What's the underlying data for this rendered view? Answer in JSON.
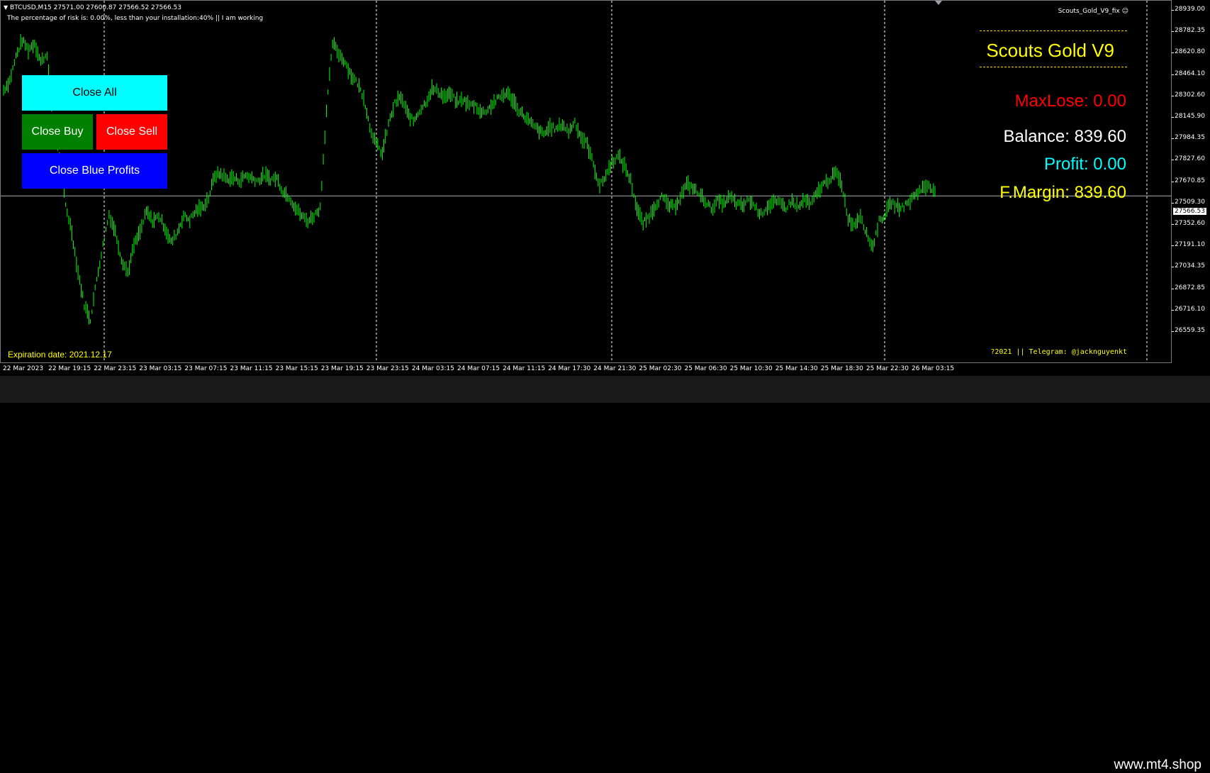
{
  "header": {
    "symbol_line": "BTCUSD,M15  27571.00 27600.87 27566.52 27566.53",
    "status_line": "The percentage of risk is: 0.00%, less than your installation:40%  || I am working",
    "ea_label": "Scouts_Gold_V9_fix"
  },
  "buttons": {
    "close_all": "Close All",
    "close_buy": "Close Buy",
    "close_sell": "Close Sell",
    "close_blue": "Close Blue Profits"
  },
  "panel": {
    "title": "Scouts Gold V9",
    "max_lose": "MaxLose: 0.00",
    "balance": "Balance: 839.60",
    "profit": "Profit: 0.00",
    "margin": "F.Margin: 839.60"
  },
  "footer": {
    "expiration": "Expiration date: 2021.12.17",
    "telegram": "?2021 || Telegram: @jacknguyenkt"
  },
  "price_axis": {
    "labels": [
      "28939.00",
      "28782.35",
      "28620.80",
      "28464.10",
      "28302.60",
      "28145.90",
      "27984.35",
      "27827.60",
      "27670.85",
      "27509.30",
      "27352.60",
      "27191.10",
      "27034.35",
      "26872.85",
      "26716.10",
      "26559.35"
    ],
    "current": "27566.53"
  },
  "time_axis": {
    "labels": [
      "22 Mar 2023",
      "22 Mar 19:15",
      "22 Mar 23:15",
      "23 Mar 03:15",
      "23 Mar 07:15",
      "23 Mar 11:15",
      "23 Mar 15:15",
      "23 Mar 19:15",
      "23 Mar 23:15",
      "24 Mar 03:15",
      "24 Mar 07:15",
      "24 Mar 11:15",
      "24 Mar 17:30",
      "24 Mar 21:30",
      "25 Mar 02:30",
      "25 Mar 06:30",
      "25 Mar 10:30",
      "25 Mar 14:30",
      "25 Mar 18:30",
      "25 Mar 22:30",
      "26 Mar 03:15"
    ]
  },
  "watermark": "www.mt4.shop",
  "colors": {
    "candles": "#00ff00",
    "title": "#ffff00",
    "maxlose": "#ff0000",
    "balance": "#ffffff",
    "profit": "#00ffff",
    "margin": "#ffff00"
  },
  "chart_data": {
    "type": "line",
    "closes": [
      28350,
      28420,
      28600,
      28720,
      28650,
      28700,
      28560,
      28620,
      28100,
      27850,
      27500,
      27300,
      27000,
      26760,
      26650,
      26950,
      27200,
      27430,
      27300,
      27100,
      27000,
      27200,
      27300,
      27450,
      27380,
      27420,
      27330,
      27220,
      27300,
      27420,
      27390,
      27460,
      27480,
      27550,
      27720,
      27730,
      27690,
      27700,
      27680,
      27720,
      27700,
      27680,
      27720,
      27690,
      27700,
      27600,
      27560,
      27480,
      27420,
      27380,
      27420,
      27480,
      28200,
      28700,
      28620,
      28560,
      28460,
      28400,
      28300,
      28080,
      27950,
      27880,
      28100,
      28250,
      28300,
      28180,
      28120,
      28200,
      28260,
      28360,
      28340,
      28300,
      28320,
      28260,
      28280,
      28240,
      28240,
      28180,
      28210,
      28260,
      28300,
      28330,
      28280,
      28200,
      28150,
      28100,
      28060,
      28020,
      28080,
      28060,
      28100,
      28040,
      28120,
      28000,
      27950,
      27800,
      27640,
      27720,
      27820,
      27860,
      27790,
      27680,
      27470,
      27360,
      27420,
      27500,
      27560,
      27500,
      27480,
      27560,
      27650,
      27630,
      27580,
      27530,
      27470,
      27530,
      27510,
      27560,
      27510,
      27490,
      27540,
      27490,
      27430,
      27490,
      27520,
      27510,
      27480,
      27530,
      27480,
      27540,
      27500,
      27590,
      27650,
      27690,
      27740,
      27650,
      27400,
      27350,
      27430,
      27280,
      27190,
      27380,
      27430,
      27520,
      27480,
      27490,
      27530,
      27590,
      27620,
      27650,
      27600
    ]
  }
}
